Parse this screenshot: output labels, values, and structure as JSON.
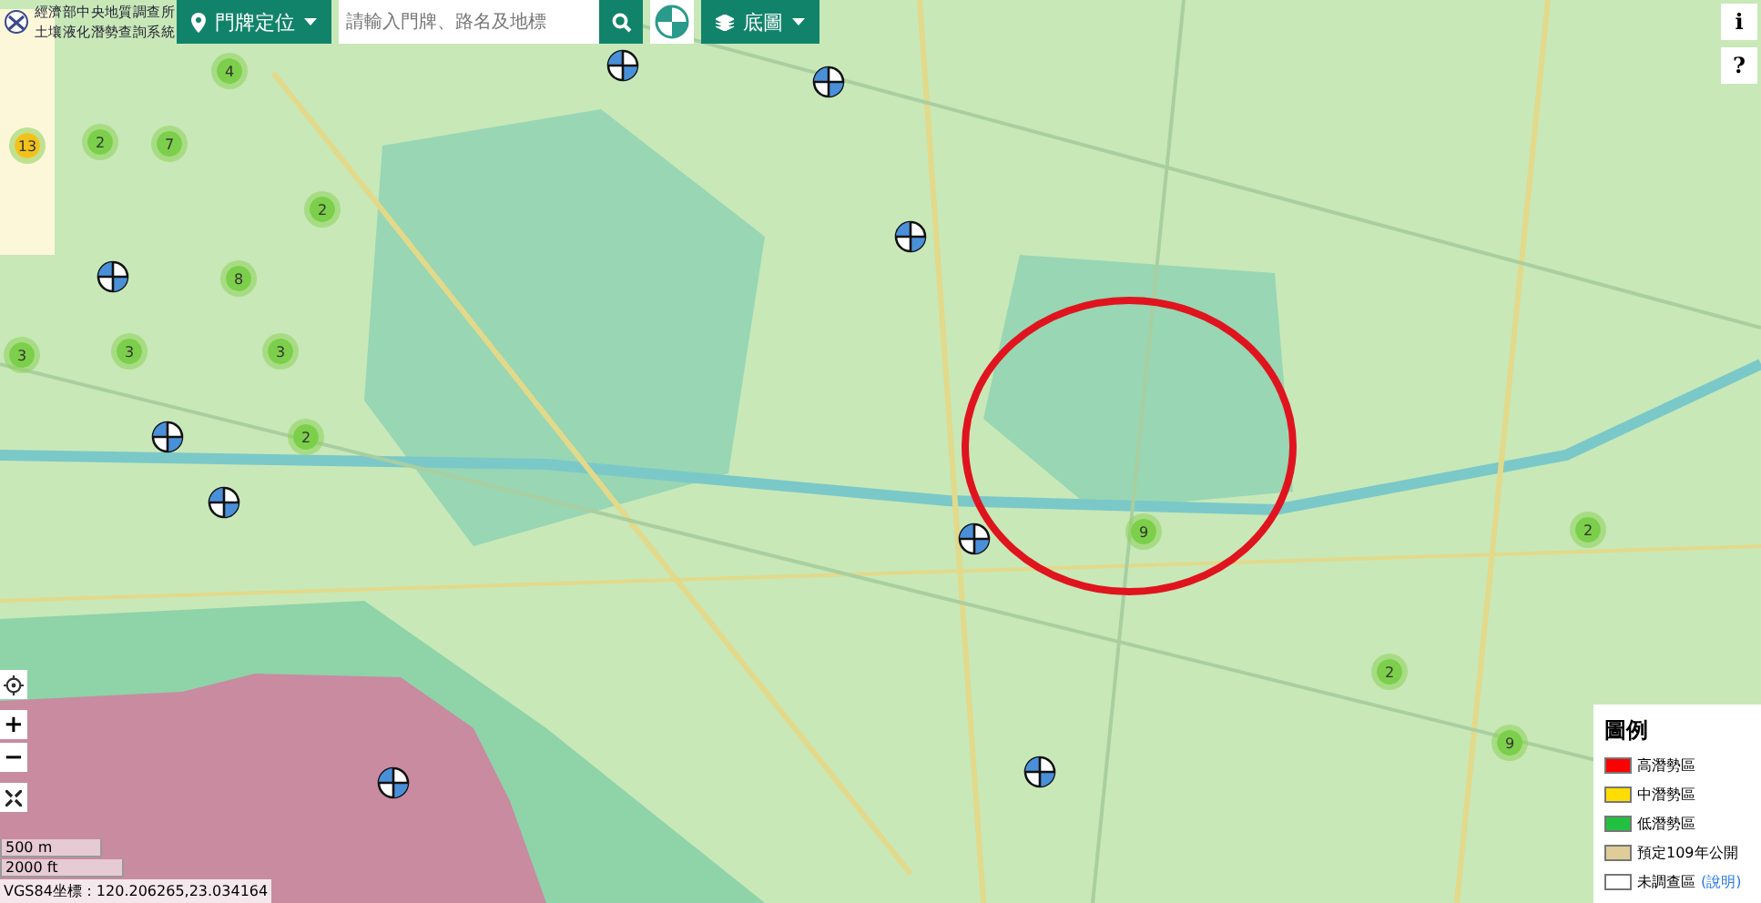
{
  "header": {
    "agency": "經濟部中央地質調查所",
    "system": "土壤液化潛勢查詢系統"
  },
  "toolbar": {
    "locate_button": "門牌定位",
    "search": {
      "placeholder": "請輸入門牌、路名及地標"
    },
    "basemap_button": "底圖"
  },
  "side_buttons": [
    "i",
    "?"
  ],
  "zoom_controls": [
    "+",
    "−"
  ],
  "markers": [
    {
      "kind": "cluster",
      "count": "4",
      "color": "#7ccf4a"
    },
    {
      "kind": "cluster",
      "count": "13",
      "color": "#f2c21c"
    },
    {
      "kind": "cluster",
      "count": "2",
      "color": "#7ccf4a"
    },
    {
      "kind": "cluster",
      "count": "7",
      "color": "#7ccf4a"
    },
    {
      "kind": "cluster",
      "count": "2",
      "color": "#7ccf4a"
    },
    {
      "kind": "cluster",
      "count": "8",
      "color": "#7ccf4a"
    },
    {
      "kind": "cluster",
      "count": "3",
      "color": "#7ccf4a"
    },
    {
      "kind": "cluster",
      "count": "3",
      "color": "#7ccf4a"
    },
    {
      "kind": "cluster",
      "count": "3",
      "color": "#7ccf4a"
    },
    {
      "kind": "cluster",
      "count": "2",
      "color": "#7ccf4a"
    },
    {
      "kind": "cluster",
      "count": "9",
      "color": "#7ccf4a"
    },
    {
      "kind": "cluster",
      "count": "2",
      "color": "#7ccf4a"
    },
    {
      "kind": "cluster",
      "count": "2",
      "color": "#7ccf4a"
    },
    {
      "kind": "cluster",
      "count": "9",
      "color": "#7ccf4a"
    },
    {
      "kind": "bore"
    },
    {
      "kind": "bore"
    },
    {
      "kind": "bore"
    },
    {
      "kind": "bore"
    },
    {
      "kind": "bore"
    },
    {
      "kind": "bore"
    },
    {
      "kind": "bore"
    },
    {
      "kind": "bore"
    },
    {
      "kind": "bore"
    }
  ],
  "legend": {
    "title": "圖例",
    "items": [
      {
        "label": "高潛勢區",
        "color": "#ff0000"
      },
      {
        "label": "中潛勢區",
        "color": "#ffdd00"
      },
      {
        "label": "低潛勢區",
        "color": "#22c040"
      },
      {
        "label": "預定109年公開",
        "color": "#e0cc99"
      },
      {
        "label": "未調查區",
        "color": "#ffffff",
        "link": "(說明)"
      }
    ]
  },
  "scale": [
    "500 m",
    "2000 ft"
  ],
  "coordinates": "VGS84坐標：120.206265,23.034164"
}
